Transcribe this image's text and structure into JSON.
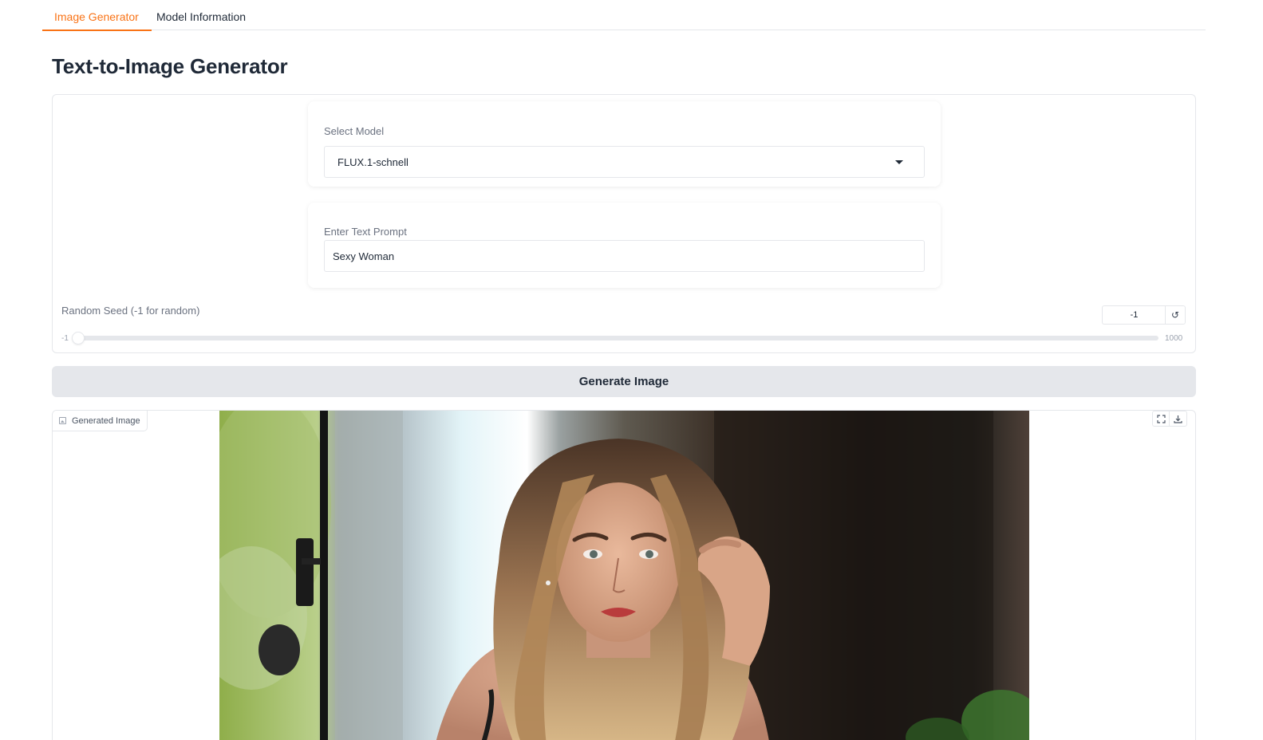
{
  "tabs": [
    {
      "label": "Image Generator",
      "active": true
    },
    {
      "label": "Model Information",
      "active": false
    }
  ],
  "page_title": "Text-to-Image Generator",
  "model": {
    "label": "Select Model",
    "value": "FLUX.1-schnell"
  },
  "prompt": {
    "label": "Enter Text Prompt",
    "value": "Sexy Woman"
  },
  "seed": {
    "label": "Random Seed (-1 for random)",
    "value": "-1",
    "min": "-1",
    "max": "1000",
    "reset_icon": "↺"
  },
  "generate_button": "Generate Image",
  "output": {
    "label": "Generated Image",
    "icons": [
      "image-icon",
      "fullscreen-icon",
      "download-icon"
    ]
  },
  "colors": {
    "accent": "#f97316",
    "border": "#e5e7eb",
    "button_bg": "#e5e7eb"
  }
}
